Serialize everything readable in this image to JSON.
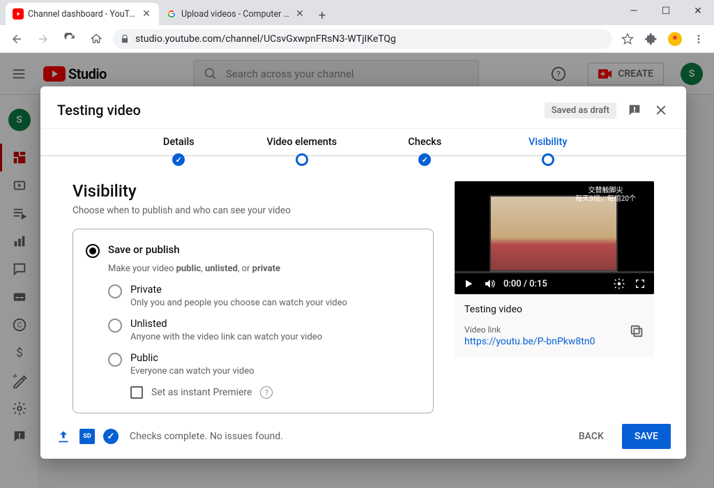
{
  "browser": {
    "tabs": [
      {
        "title": "Channel dashboard - YouTube St"
      },
      {
        "title": "Upload videos - Computer - Yo"
      }
    ],
    "url": "studio.youtube.com/channel/UCsvGxwpnFRsN3-WTjIKeTQg"
  },
  "header": {
    "logo_text": "Studio",
    "search_placeholder": "Search across your channel",
    "create_label": "CREATE",
    "avatar_initial": "S"
  },
  "left_rail": {
    "avatar_initial": "S"
  },
  "dialog": {
    "title": "Testing video",
    "saved_badge": "Saved as draft",
    "stepper": {
      "details": "Details",
      "elements": "Video elements",
      "checks": "Checks",
      "visibility": "Visibility"
    },
    "visibility": {
      "heading": "Visibility",
      "subtitle": "Choose when to publish and who can see your video",
      "save_publish": {
        "title": "Save or publish",
        "desc_prefix": "Make your video ",
        "desc_bold1": "public",
        "desc_mid1": ", ",
        "desc_bold2": "unlisted",
        "desc_mid2": ", or ",
        "desc_bold3": "private"
      },
      "private": {
        "title": "Private",
        "desc": "Only you and people you choose can watch your video"
      },
      "unlisted": {
        "title": "Unlisted",
        "desc": "Anyone with the video link can watch your video"
      },
      "public": {
        "title": "Public",
        "desc": "Everyone can watch your video"
      },
      "premiere_label": "Set as instant Premiere"
    },
    "preview": {
      "thumb_caption_1": "交替触脚尖",
      "thumb_caption_2": "每天3组，每组20个",
      "time": "0:00 / 0:15",
      "video_name": "Testing video",
      "link_label": "Video link",
      "video_link": "https://youtu.be/P-bnPkw8tn0"
    },
    "footer": {
      "sd_label": "SD",
      "checks_text": "Checks complete. No issues found.",
      "back_label": "BACK",
      "save_label": "SAVE"
    }
  }
}
